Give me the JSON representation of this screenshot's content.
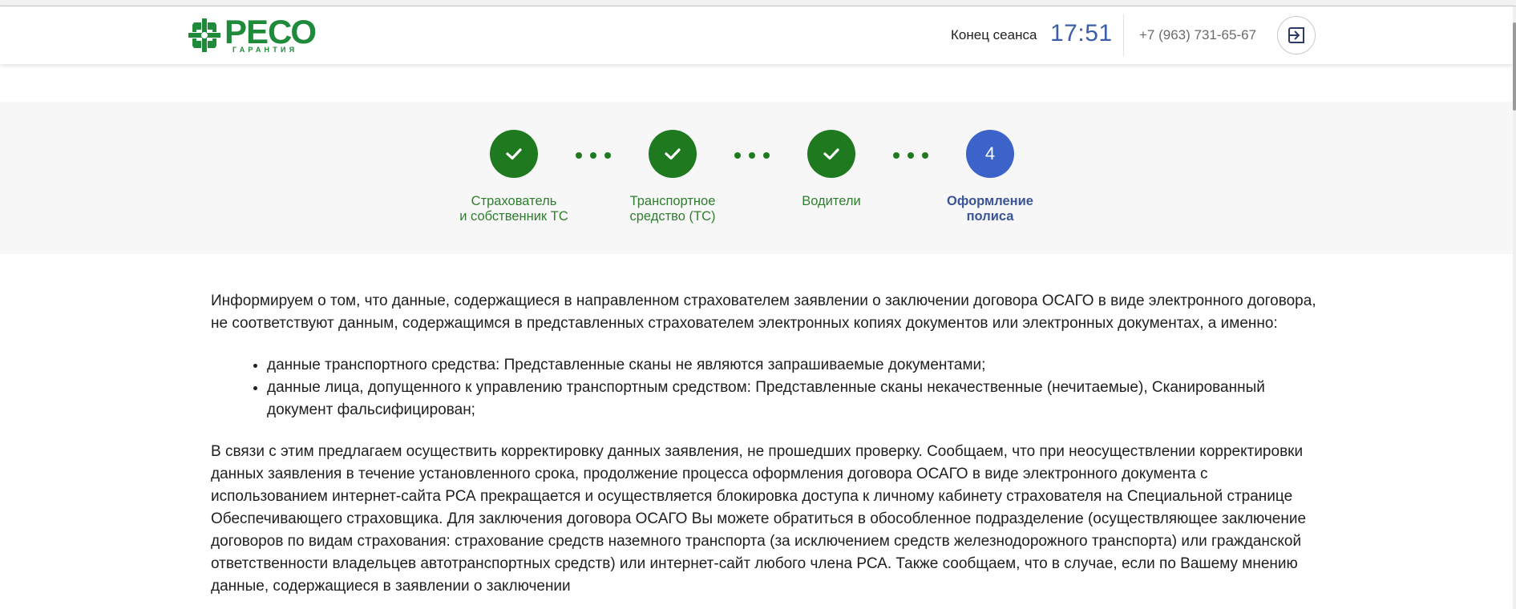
{
  "brand": {
    "logo_main": "РЕСО",
    "logo_sub": "ГАРАНТИЯ",
    "color": "#1e8a3a"
  },
  "header": {
    "session_label": "Конец сеанса",
    "session_time": "17:51",
    "phone": "+7 (963) 731-65-67",
    "logout_icon": "logout-icon"
  },
  "steps": [
    {
      "state": "done",
      "label_line1": "Страхователь",
      "label_line2": "и собственник ТС"
    },
    {
      "state": "done",
      "label_line1": "Транспортное",
      "label_line2": "средство (ТС)"
    },
    {
      "state": "done",
      "label_line1": "Водители",
      "label_line2": ""
    },
    {
      "state": "active",
      "number": "4",
      "label_line1": "Оформление",
      "label_line2": "полиса"
    }
  ],
  "colors": {
    "step_done": "#1f7a1f",
    "step_active": "#3c63c9",
    "time_color": "#3a5fa8"
  },
  "content": {
    "intro": "Информируем о том, что данные, содержащиеся в направленном страхователем заявлении о заключении договора ОСАГО в виде электронного договора, не соответствуют данным, содержащимся в представленных страхователем электронных копиях документов или электронных документах, а именно:",
    "issues": [
      "данные транспортного средства: Представленные сканы не являются запрашиваемые документами;",
      "данные лица, допущенного к управлению транспортным средством: Представленные сканы некачественные (нечитаемые), Сканированный документ фальсифицирован;"
    ],
    "followup": "В связи с этим предлагаем осуществить корректировку данных заявления, не прошедших проверку. Сообщаем, что при неосуществлении корректировки данных заявления в течение установленного срока, продолжение процесса оформления договора ОСАГО в виде электронного документа с использованием интернет-сайта РСА прекращается и осуществляется блокировка доступа к личному кабинету страхователя на Специальной странице Обеспечивающего страховщика. Для заключения договора ОСАГО Вы можете обратиться в обособленное подразделение (осуществляющее заключение договоров по видам страхования: страхование средств наземного транспорта (за исключением средств железнодорожного транспорта) или гражданской ответственности владельцев автотранспортных средств) или интернет-сайт любого члена РСА. Также сообщаем, что в случае, если по Вашему мнению данные, содержащиеся в заявлении о заключении"
  }
}
